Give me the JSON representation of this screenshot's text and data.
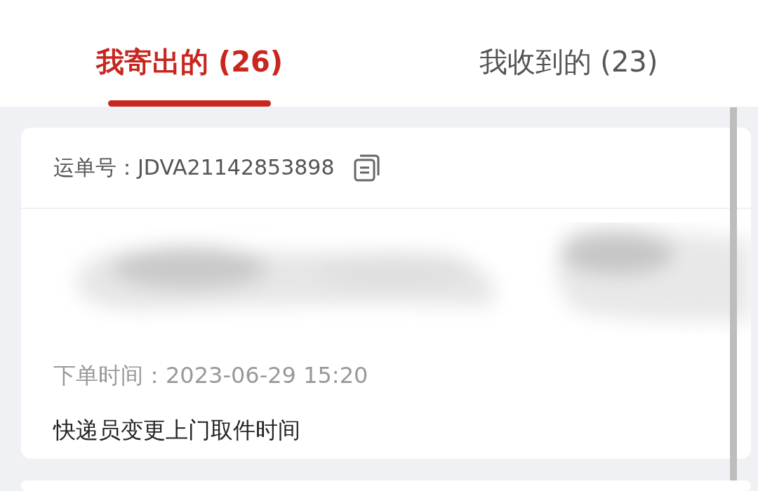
{
  "tabs": [
    {
      "label": "我寄出的 (26)",
      "selected": true
    },
    {
      "label": "我收到的 (23)",
      "selected": false
    }
  ],
  "orders": [
    {
      "waybill_label": "运单号：",
      "waybill": "JDVA21142853898",
      "order_time_label": "下单时间：",
      "order_time": "2023-06-29 15:20",
      "message": "快递员变更上门取件时间"
    }
  ]
}
